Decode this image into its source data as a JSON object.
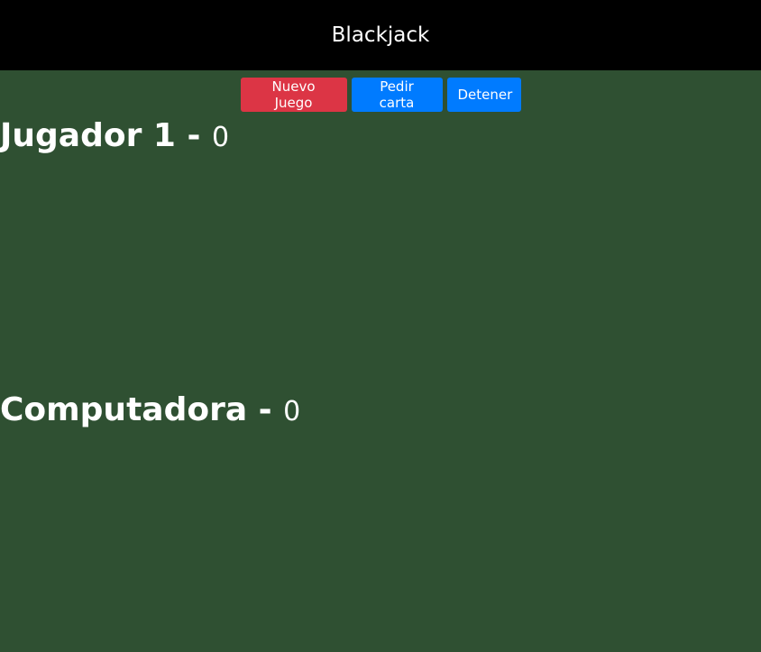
{
  "header": {
    "title": "Blackjack"
  },
  "controls": {
    "new_game": "Nuevo Juego",
    "hit": "Pedir carta",
    "stand": "Detener"
  },
  "players": [
    {
      "name": "Jugador 1",
      "separator": "-",
      "score": "0"
    },
    {
      "name": "Computadora",
      "separator": "-",
      "score": "0"
    }
  ],
  "colors": {
    "background": "#2f5032",
    "header": "#000000",
    "danger": "#dc3545",
    "primary": "#007bff"
  }
}
